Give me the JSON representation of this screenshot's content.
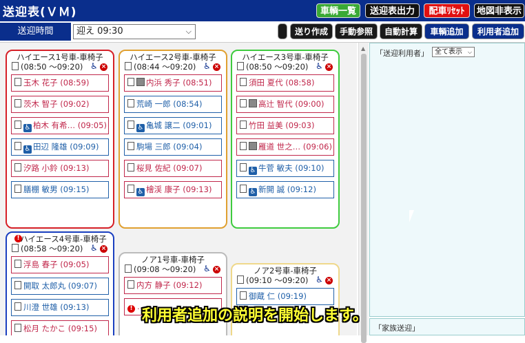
{
  "app": {
    "title": "送迎表(ＶＭ)"
  },
  "header_buttons": [
    {
      "label": "車輌一覧",
      "color": "#3aa935"
    },
    {
      "label": "送迎表出力",
      "color": "#111111"
    },
    {
      "label": "配車ﾘｾｯﾄ",
      "color": "#e01010"
    },
    {
      "label": "地図非表示",
      "color": "#111111"
    }
  ],
  "toolbar": {
    "time_label": "送迎時間",
    "time_value": "迎え 09:30",
    "buttons": [
      "",
      "送り作成",
      "手動参照",
      "自動計算",
      "車輌追加",
      "利用者追加"
    ]
  },
  "side": {
    "title": "「送迎利用者」",
    "filter": "全て表示",
    "family_title": "「家族送迎」"
  },
  "cars": [
    {
      "name": "ハイエース1号車-車椅子",
      "time": "(08:50 ～09:20)",
      "color": "#d61f26",
      "warn": false,
      "pax": [
        {
          "t": "f",
          "text": "玉木 花子 (08:59)"
        },
        {
          "t": "f",
          "text": "茨木 智子 (09:02)"
        },
        {
          "t": "f",
          "wc": true,
          "text": "柏木 有希… (09:05)"
        },
        {
          "t": "m",
          "wc": true,
          "text": "田辺 隆雄 (09:09)"
        },
        {
          "t": "f",
          "text": "汐路 小鈴 (09:13)"
        },
        {
          "t": "m",
          "text": "膳棚 敏男 (09:15)"
        }
      ]
    },
    {
      "name": "ハイエース2号車-車椅子",
      "time": "(08:44 ～09:20)",
      "color": "#e0a030",
      "warn": false,
      "pax": [
        {
          "t": "f",
          "pic": true,
          "text": "内浜 秀子 (08:51)"
        },
        {
          "t": "m",
          "text": "荒崎 一郎 (08:54)"
        },
        {
          "t": "m",
          "wc": true,
          "text": "亀城 譲二 (09:01)"
        },
        {
          "t": "m",
          "text": "駒場 三郎 (09:04)"
        },
        {
          "t": "f",
          "text": "桜見 佐紀 (09:07)"
        },
        {
          "t": "f",
          "wc": true,
          "text": "檜渓 康子 (09:13)"
        }
      ]
    },
    {
      "name": "ハイエース3号車-車椅子",
      "time": "(08:50 ～09:20)",
      "color": "#3ecb3e",
      "warn": false,
      "pax": [
        {
          "t": "f",
          "text": "須田 夏代 (08:58)"
        },
        {
          "t": "f",
          "pic": true,
          "text": "高辻 智代 (09:00)"
        },
        {
          "t": "f",
          "text": "竹田 益美 (09:03)"
        },
        {
          "t": "f",
          "pic": true,
          "text": "雁道 世之… (09:06)"
        },
        {
          "t": "m",
          "wc": true,
          "text": "牛菅 敏夫 (09:10)"
        },
        {
          "t": "m",
          "wc": true,
          "text": "新開 誠 (09:12)"
        }
      ]
    },
    {
      "name": "ハイエース4号車-車椅子",
      "time": "(08:58 ～09:20)",
      "color": "#1a3fc0",
      "warn": true,
      "pax": [
        {
          "t": "f",
          "text": "浮島 春子 (09:05)"
        },
        {
          "t": "m",
          "text": "開取 太郎丸 (09:07)"
        },
        {
          "t": "m",
          "text": "川澄 世雄 (09:13)"
        },
        {
          "t": "f",
          "text": "松月 たかこ (09:15)"
        }
      ]
    },
    {
      "name": "ノア1号車-車椅子",
      "time": "(09:08 ～09:20)",
      "color": "#bbbbbb",
      "warn": false,
      "pax": [
        {
          "t": "f",
          "text": "内方 静子 (09:12)"
        },
        {
          "t": "f",
          "warn": true,
          "text": "…"
        }
      ]
    },
    {
      "name": "ノア2号車-車椅子",
      "time": "(09:10 ～09:20)",
      "color": "#efd88a",
      "warn": false,
      "pax": [
        {
          "t": "m",
          "text": "御蔵 仁 (09:19)"
        }
      ]
    }
  ],
  "caption": "利用者追加の説明を開始します。"
}
